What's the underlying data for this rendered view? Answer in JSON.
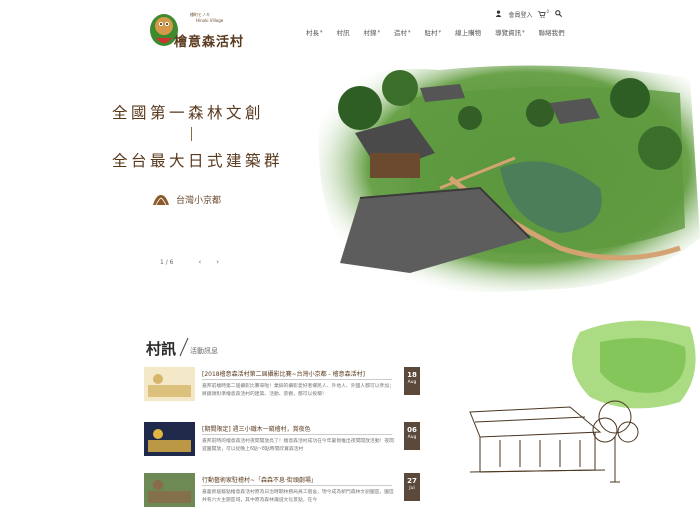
{
  "header": {
    "logo_text": "檜意森活村",
    "logo_en": "Hinoki Village",
    "logo_tag": "檜町ヒノキ",
    "member_label": "會員登入",
    "cart_count": "0"
  },
  "nav": [
    {
      "label": "村長",
      "dropdown": true
    },
    {
      "label": "村訊",
      "dropdown": false
    },
    {
      "label": "村錦",
      "dropdown": true
    },
    {
      "label": "造村",
      "dropdown": true
    },
    {
      "label": "駐村",
      "dropdown": true
    },
    {
      "label": "線上購物",
      "dropdown": false
    },
    {
      "label": "導覽資訊",
      "dropdown": true
    },
    {
      "label": "聯絡我們",
      "dropdown": false
    }
  ],
  "hero": {
    "tagline1": "全國第一森林文創",
    "tagline2": "全台最大日式建築群",
    "subtag": "台灣小京都",
    "pager": "1 / 6"
  },
  "news": {
    "title": "村訊",
    "subtitle": "活動訊息",
    "items": [
      {
        "headline": "[2018檜意森活村第二屆攝影比賽~台灣小京都 - 檜意森活村]",
        "desc": "嘉邦前檜時第二屆攝影比賽來啦！業餘的攝影愛好者鄉民人、外地人、外國人都可以參加；將鏡頭對準檜意森活村的建築、活動、景觀，都可以投稿！",
        "day": "18",
        "month": "Aug"
      },
      {
        "headline": "[期間限定] 週三小鐵木一窺檜村，賞夜色",
        "desc": "嘉邦前時的檜意森活村夜間開放亮了！檜意森活村成功在今年暑假推出夜間開放活動！夜間遊園開放，可以從晚上6點~8點時間欣賞森活村",
        "day": "06",
        "month": "Aug"
      },
      {
        "headline": "行動藝術家駐檜村~「森森不息·街頭劇場」",
        "desc": "嘉義新居藝點檜意森活村原為日治時期林務局員工宿舍，現今成為新門森林文創園區，園區共有六大主題區域，其中原為森林鐵道文化景點，在今",
        "day": "27",
        "month": "Jul"
      }
    ]
  },
  "colors": {
    "brand_brown": "#5a3a1e",
    "date_badge": "#5b4a3c",
    "accent_green": "#7cc24a"
  }
}
